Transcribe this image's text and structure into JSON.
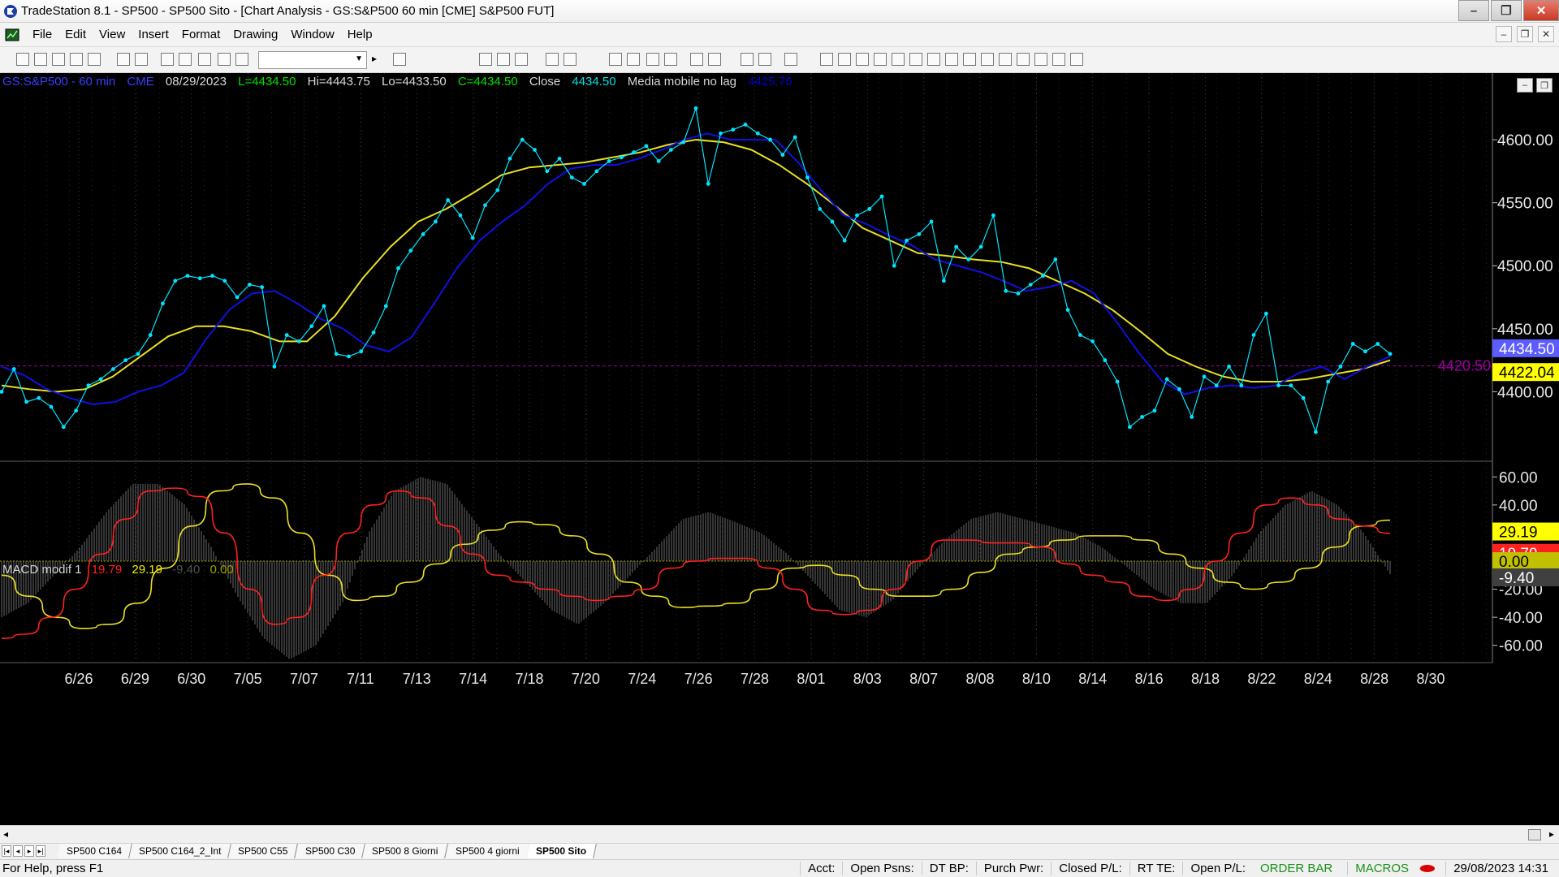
{
  "window": {
    "title": "TradeStation 8.1 - SP500 - SP500 Sito - [Chart Analysis - GS:S&P500  60 min  [CME] S&P500 FUT]",
    "buttons": [
      "–",
      "❐",
      "✕"
    ]
  },
  "menu": {
    "items": [
      "File",
      "Edit",
      "View",
      "Insert",
      "Format",
      "Drawing",
      "Window",
      "Help"
    ],
    "mdi_buttons": [
      "–",
      "❐",
      "✕"
    ]
  },
  "chart_header": {
    "symbol": "GS:S&P500 - 60 min",
    "exchange": "CME",
    "date": "08/29/2023",
    "last": "L=4434.50",
    "high": "Hi=4443.75",
    "low": "Lo=4433.50",
    "close_value": "C=4434.50",
    "close_label": "Close",
    "close_price": "4434.50",
    "indicator_name": "Media mobile no lag",
    "indicator_value": "4425.76",
    "colors": {
      "symbol": "#3c3cff",
      "last": "#00e000",
      "close": "#00e000",
      "close_price": "#00e0e0",
      "indicator_value": "#0000cc"
    }
  },
  "macd_header": {
    "name": "MACD modif 1",
    "values": [
      "19.79",
      "29.19",
      "-9.40",
      "0.00"
    ],
    "colors": [
      "#ff2020",
      "#f0f000",
      "#505050",
      "#a0a000"
    ]
  },
  "price_axis": {
    "labels": [
      "4600.00",
      "4550.00",
      "4500.00",
      "4450.00",
      "4400.00"
    ],
    "tags": {
      "last": "4434.50",
      "ma": "4422.04",
      "ref_line": "4420.50"
    },
    "tag_colors": {
      "last": "#5c5cff",
      "ma": "#ffff00",
      "ref_line": "#a000a0"
    }
  },
  "macd_axis": {
    "labels": [
      "60.00",
      "40.00",
      "20.00",
      "0.00",
      "-20.00",
      "-40.00",
      "-60.00"
    ],
    "tags": [
      "29.19",
      "19.79",
      "0.00",
      "-9.40"
    ],
    "tag_colors": [
      "#ffff00",
      "#ff2020",
      "#c0c000",
      "#404040"
    ]
  },
  "date_axis": {
    "labels": [
      "6/26",
      "6/29",
      "6/30",
      "7/05",
      "7/07",
      "7/11",
      "7/13",
      "7/14",
      "7/18",
      "7/20",
      "7/24",
      "7/26",
      "7/28",
      "8/01",
      "8/03",
      "8/07",
      "8/08",
      "8/10",
      "8/14",
      "8/16",
      "8/18",
      "8/22",
      "8/24",
      "8/28",
      "8/30"
    ]
  },
  "chart_data": {
    "type": "line",
    "ylim": [
      4350,
      4640
    ],
    "macd_ylim": [
      -70,
      70
    ],
    "series": [
      {
        "name": "Close",
        "color": "#00e5ff",
        "values": [
          4400,
          4418,
          4392,
          4395,
          4388,
          4372,
          4385,
          4405,
          4410,
          4418,
          4425,
          4430,
          4445,
          4470,
          4488,
          4492,
          4490,
          4492,
          4488,
          4475,
          4485,
          4483,
          4420,
          4445,
          4440,
          4452,
          4468,
          4430,
          4428,
          4432,
          4447,
          4468,
          4498,
          4512,
          4525,
          4535,
          4552,
          4540,
          4522,
          4548,
          4560,
          4585,
          4600,
          4592,
          4575,
          4585,
          4570,
          4565,
          4575,
          4583,
          4586,
          4590,
          4595,
          4583,
          4592,
          4598,
          4625,
          4565,
          4605,
          4608,
          4612,
          4605,
          4600,
          4588,
          4602,
          4570,
          4545,
          4535,
          4520,
          4540,
          4545,
          4555,
          4500,
          4520,
          4525,
          4535,
          4488,
          4515,
          4505,
          4515,
          4540,
          4480,
          4478,
          4485,
          4492,
          4505,
          4465,
          4445,
          4440,
          4425,
          4408,
          4372,
          4380,
          4385,
          4410,
          4402,
          4380,
          4412,
          4405,
          4420,
          4405,
          4445,
          4462,
          4405,
          4405,
          4395,
          4368,
          4408,
          4420,
          4438,
          4432,
          4438,
          4430
        ]
      },
      {
        "name": "Media mobile no lag",
        "color": "#1010e0",
        "values": [
          4420,
          4413,
          4402,
          4395,
          4390,
          4392,
          4400,
          4405,
          4415,
          4442,
          4465,
          4478,
          4480,
          4470,
          4458,
          4450,
          4437,
          4432,
          4443,
          4470,
          4498,
          4520,
          4535,
          4548,
          4565,
          4577,
          4580,
          4580,
          4585,
          4592,
          4600,
          4605,
          4600,
          4600,
          4600,
          4582,
          4560,
          4540,
          4533,
          4524,
          4516,
          4505,
          4500,
          4495,
          4488,
          4480,
          4483,
          4488,
          4478,
          4455,
          4430,
          4408,
          4398,
          4403,
          4405,
          4403,
          4405,
          4415,
          4420,
          4410,
          4420,
          4428
        ]
      },
      {
        "name": "Media mobile",
        "color": "#e8e020",
        "values": [
          4405,
          4402,
          4400,
          4402,
          4412,
          4428,
          4444,
          4452,
          4452,
          4448,
          4440,
          4440,
          4460,
          4490,
          4515,
          4535,
          4545,
          4558,
          4572,
          4578,
          4580,
          4582,
          4586,
          4590,
          4596,
          4600,
          4598,
          4592,
          4580,
          4565,
          4548,
          4530,
          4520,
          4510,
          4508,
          4505,
          4503,
          4498,
          4488,
          4478,
          4465,
          4448,
          4430,
          4420,
          4412,
          4408,
          4408,
          4410,
          4414,
          4418,
          4425
        ]
      }
    ],
    "macd_series": [
      {
        "name": "MACD",
        "color": "#ff2020",
        "values": [
          -55,
          -52,
          -40,
          -20,
          5,
          30,
          50,
          52,
          46,
          20,
          -20,
          -45,
          -40,
          -10,
          20,
          40,
          50,
          45,
          25,
          5,
          -10,
          -15,
          -20,
          -25,
          -28,
          -25,
          -20,
          -5,
          0,
          2,
          2,
          -5,
          -20,
          -35,
          -38,
          -35,
          -20,
          0,
          15,
          15,
          13,
          13,
          10,
          -2,
          -10,
          -15,
          -25,
          -28,
          -20,
          0,
          20,
          40,
          45,
          40,
          30,
          25,
          19.79
        ]
      },
      {
        "name": "Signal",
        "color": "#e8e020",
        "values": [
          -10,
          -25,
          -40,
          -48,
          -45,
          -30,
          -5,
          25,
          50,
          55,
          45,
          20,
          -10,
          -28,
          -25,
          -15,
          -2,
          12,
          22,
          28,
          26,
          18,
          5,
          -15,
          -25,
          -33,
          -32,
          -30,
          -20,
          -5,
          -3,
          -10,
          -20,
          -25,
          -25,
          -20,
          -8,
          5,
          10,
          15,
          18,
          18,
          15,
          5,
          -5,
          -15,
          -20,
          -15,
          -5,
          10,
          25,
          29.19
        ]
      },
      {
        "name": "Histogram",
        "color": "#707070",
        "values": [
          -40,
          -30,
          -10,
          10,
          35,
          55,
          55,
          40,
          10,
          -25,
          -55,
          -70,
          -60,
          -30,
          20,
          50,
          60,
          55,
          30,
          5,
          -15,
          -35,
          -45,
          -30,
          -10,
          10,
          30,
          35,
          28,
          20,
          5,
          -15,
          -35,
          -40,
          -28,
          -5,
          15,
          30,
          35,
          30,
          25,
          20,
          10,
          -5,
          -20,
          -30,
          -30,
          -10,
          20,
          40,
          50,
          40,
          20,
          -9.4
        ]
      }
    ]
  },
  "tabs": [
    "SP500 C164",
    "SP500 C164_2_Int",
    "SP500 C55",
    "SP500 C30",
    "SP500 8 Giorni",
    "SP500 4 giorni",
    "SP500 Sito"
  ],
  "status_bar": {
    "help": "For Help, press F1",
    "fields": [
      "Acct:",
      "Open Psns:",
      "DT BP:",
      "Purch Pwr:",
      "Closed P/L:",
      "RT TE:",
      "Open P/L:"
    ],
    "order_bar": "ORDER BAR",
    "macros": "MACROS",
    "datetime": "29/08/2023 14:31"
  }
}
